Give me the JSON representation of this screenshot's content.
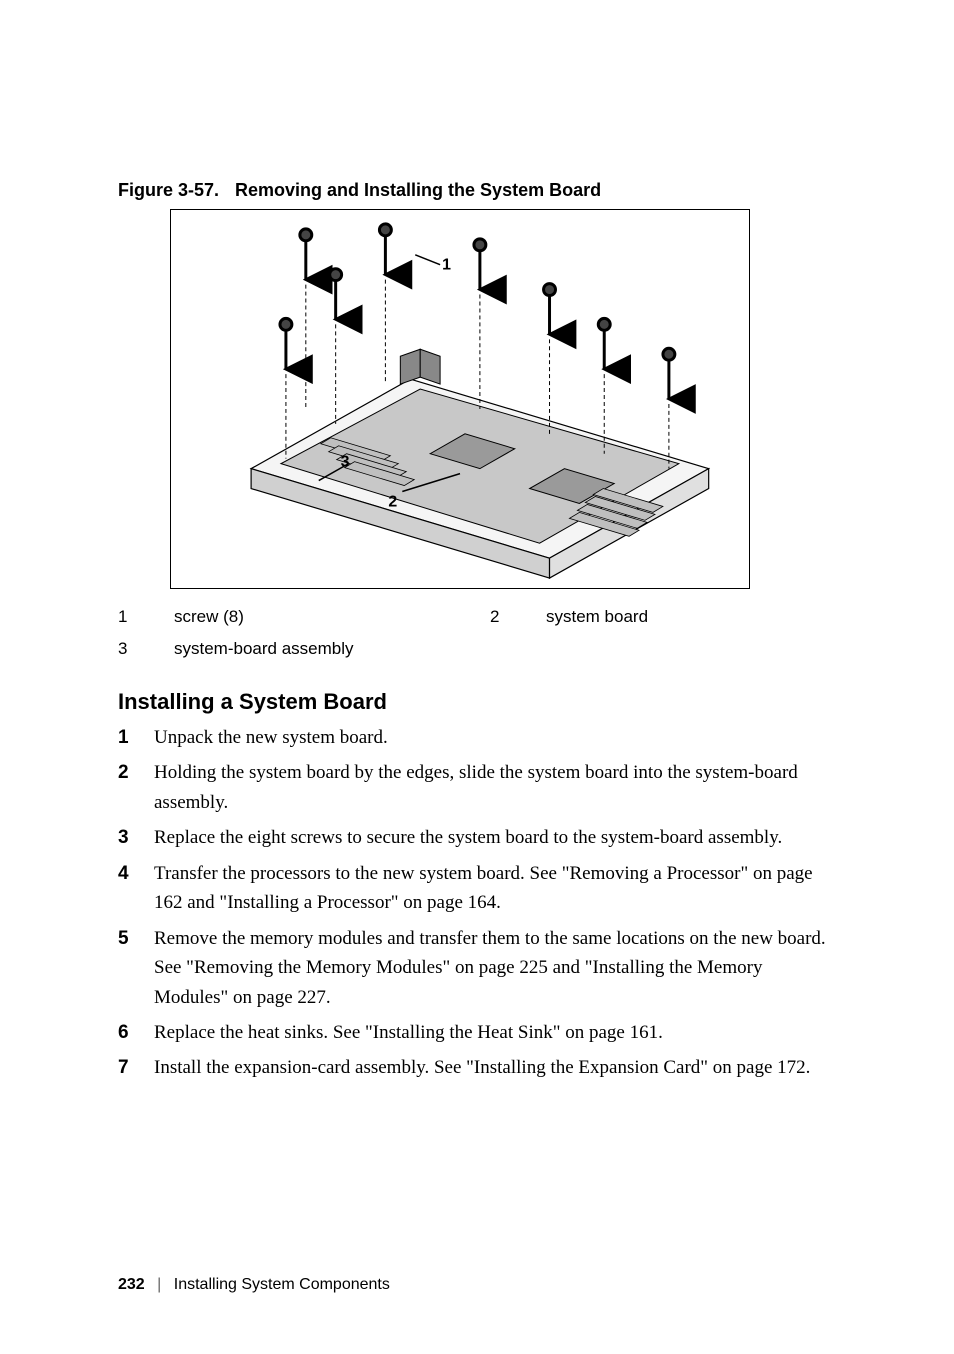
{
  "figure": {
    "number": "Figure 3-57.",
    "title": "Removing and Installing the System Board",
    "callout_1": "1",
    "callout_2": "2",
    "callout_3": "3"
  },
  "callouts": [
    {
      "num": "1",
      "label": "screw (8)"
    },
    {
      "num": "2",
      "label": "system board"
    },
    {
      "num": "3",
      "label": "system-board assembly"
    }
  ],
  "section_heading": "Installing a System Board",
  "steps": [
    {
      "n": "1",
      "text": "Unpack the new system board."
    },
    {
      "n": "2",
      "text": "Holding the system board by the edges, slide the system board into the system-board assembly."
    },
    {
      "n": "3",
      "text": "Replace the eight screws to secure the system board to the system-board assembly."
    },
    {
      "n": "4",
      "text": "Transfer the processors to the new system board. See \"Removing a Processor\" on page 162 and \"Installing a Processor\" on page 164."
    },
    {
      "n": "5",
      "text": "Remove the memory modules and transfer them to the same locations on the new board. See \"Removing the Memory Modules\" on page 225 and \"Installing the Memory Modules\" on page 227."
    },
    {
      "n": "6",
      "text": "Replace the heat sinks. See \"Installing the Heat Sink\" on page 161."
    },
    {
      "n": "7",
      "text": "Install the expansion-card assembly. See \"Installing the Expansion Card\" on page 172."
    }
  ],
  "footer": {
    "page_number": "232",
    "section_label": "Installing System Components"
  }
}
